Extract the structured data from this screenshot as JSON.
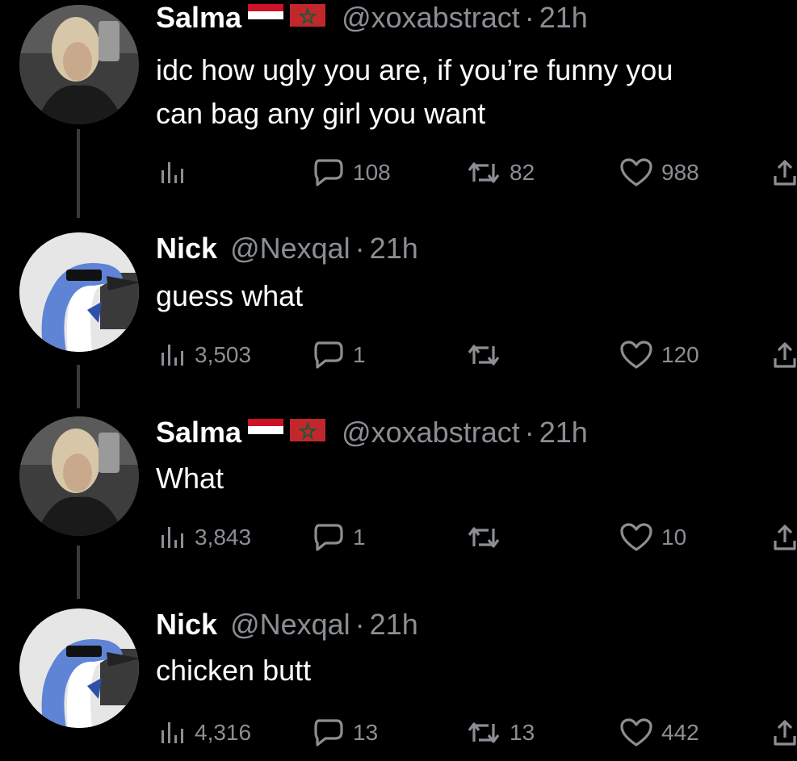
{
  "colors": {
    "background": "#000000",
    "text": "#ffffff",
    "muted": "#8b8f94",
    "thread_line": "#3a3a3a"
  },
  "tweets": [
    {
      "name": "Salma",
      "handle": "@xoxabstract",
      "sep": "·",
      "time": "21h",
      "flags": [
        "yemen-flag",
        "morocco-flag"
      ],
      "avatar": "salma-avatar",
      "lines": [
        "idc how ugly you are, if you’re funny you",
        "can bag any girl you want"
      ],
      "views": "",
      "replies": "108",
      "reposts": "82",
      "likes": "988"
    },
    {
      "name": "Nick",
      "handle": "@Nexqal",
      "sep": "·",
      "time": "21h",
      "flags": [],
      "avatar": "nick-avatar",
      "lines": [
        "guess what"
      ],
      "views": "3,503",
      "replies": "1",
      "reposts": "",
      "likes": "120"
    },
    {
      "name": "Salma",
      "handle": "@xoxabstract",
      "sep": "·",
      "time": "21h",
      "flags": [
        "yemen-flag",
        "morocco-flag"
      ],
      "avatar": "salma-avatar",
      "lines": [
        "What"
      ],
      "views": "3,843",
      "replies": "1",
      "reposts": "",
      "likes": "10"
    },
    {
      "name": "Nick",
      "handle": "@Nexqal",
      "sep": "·",
      "time": "21h",
      "flags": [],
      "avatar": "nick-avatar",
      "lines": [
        "chicken butt"
      ],
      "views": "4,316",
      "replies": "13",
      "reposts": "13",
      "likes": "442"
    }
  ]
}
